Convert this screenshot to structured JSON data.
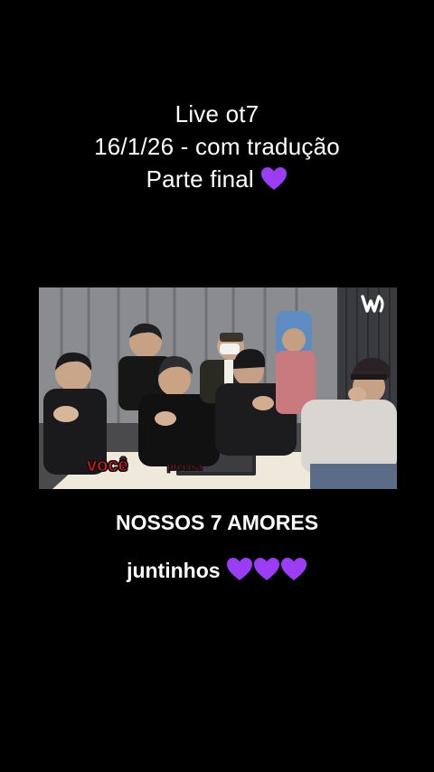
{
  "overlay_title": {
    "line1": "Live ot7",
    "line2": "16/1/26 - com tradução",
    "line3": "Parte final"
  },
  "video": {
    "subtitle_word1": "você",
    "subtitle_word2": "precisa",
    "logo_icon": "weverse-logo-icon"
  },
  "caption": {
    "line1": "NOSSOS 7 AMORES",
    "line2": "juntinhos"
  },
  "colors": {
    "background": "#000000",
    "text": "#ffffff",
    "heart": "#9b3df5",
    "subtitle": "#e0191f"
  }
}
